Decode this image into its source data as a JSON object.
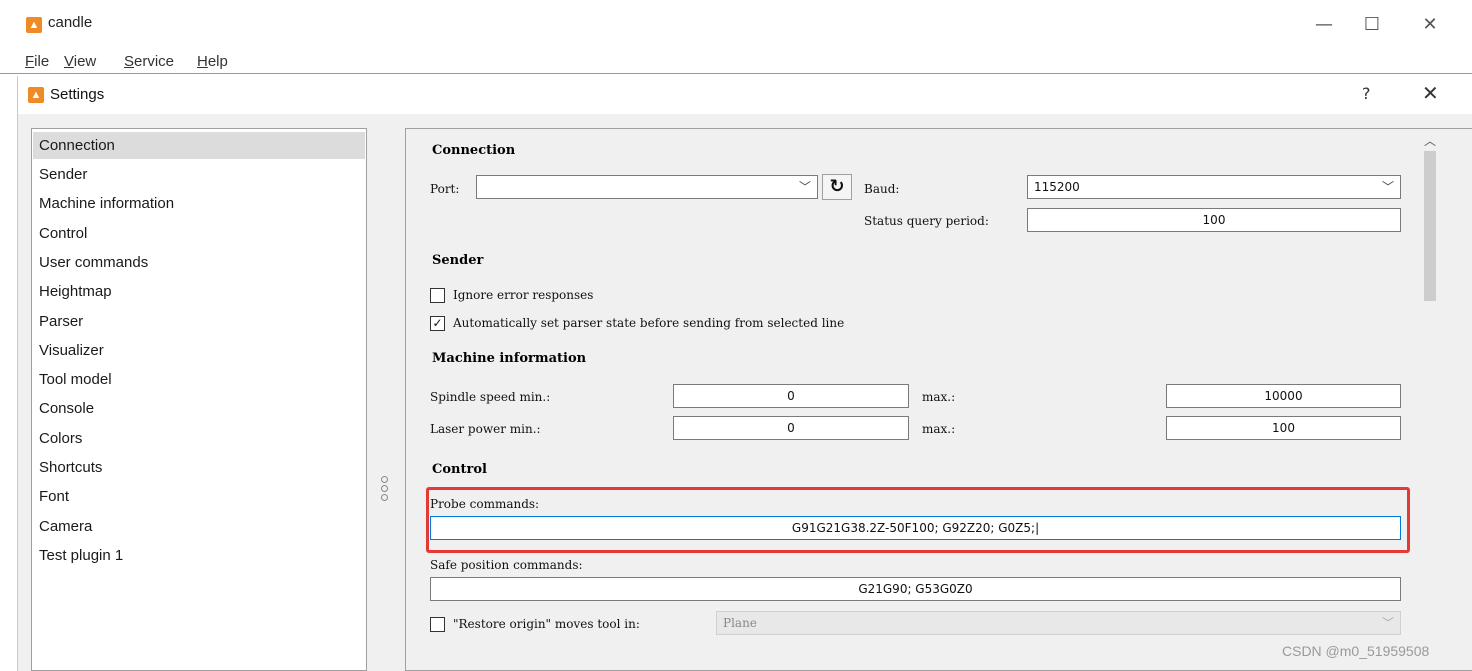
{
  "window": {
    "title": "candle",
    "minimize": "—",
    "maximize": "☐",
    "close": "✕"
  },
  "menu": [
    {
      "label": "File",
      "key": "F",
      "rest": "ile"
    },
    {
      "label": "View",
      "key": "V",
      "rest": "iew"
    },
    {
      "label": "Service",
      "key": "S",
      "rest": "ervice"
    },
    {
      "label": "Help",
      "key": "H",
      "rest": "elp"
    }
  ],
  "dialog": {
    "title": "Settings",
    "help": "?",
    "close": "✕"
  },
  "sidebar": {
    "items": [
      {
        "label": "Connection",
        "selected": true
      },
      {
        "label": "Sender"
      },
      {
        "label": "Machine information"
      },
      {
        "label": "Control"
      },
      {
        "label": "User commands"
      },
      {
        "label": "Heightmap"
      },
      {
        "label": "Parser"
      },
      {
        "label": "Visualizer"
      },
      {
        "label": "Tool model"
      },
      {
        "label": "Console"
      },
      {
        "label": "Colors"
      },
      {
        "label": "Shortcuts"
      },
      {
        "label": "Font"
      },
      {
        "label": "Camera"
      },
      {
        "label": "Test plugin 1"
      }
    ]
  },
  "connection": {
    "heading": "Connection",
    "port_label": "Port:",
    "port_value": "",
    "baud_label": "Baud:",
    "baud_value": "115200",
    "status_label": "Status query period:",
    "status_value": "100"
  },
  "sender": {
    "heading": "Sender",
    "ignore_errors": {
      "label": "Ignore error responses",
      "checked": false
    },
    "auto_parser": {
      "label": "Automatically set parser state before sending from selected line",
      "checked": true
    }
  },
  "machine": {
    "heading": "Machine information",
    "spindle_label": "Spindle speed min.:",
    "spindle_min": "0",
    "spindle_max_label": "max.:",
    "spindle_max": "10000",
    "laser_label": "Laser power min.:",
    "laser_min": "0",
    "laser_max_label": "max.:",
    "laser_max": "100"
  },
  "control": {
    "heading": "Control",
    "probe_label": "Probe commands:",
    "probe_value": "G91G21G38.2Z-50F100; G92Z20; G0Z5;|",
    "safe_label": "Safe position commands:",
    "safe_value": "G21G90; G53G0Z0",
    "restore_label": "\"Restore origin\" moves tool in:",
    "restore_checked": false,
    "restore_value": "Plane"
  },
  "watermark": "CSDN @m0_51959508",
  "colors": {
    "highlight": "#e53935",
    "focus": "#0078d7",
    "app_icon": "#f08a24"
  }
}
